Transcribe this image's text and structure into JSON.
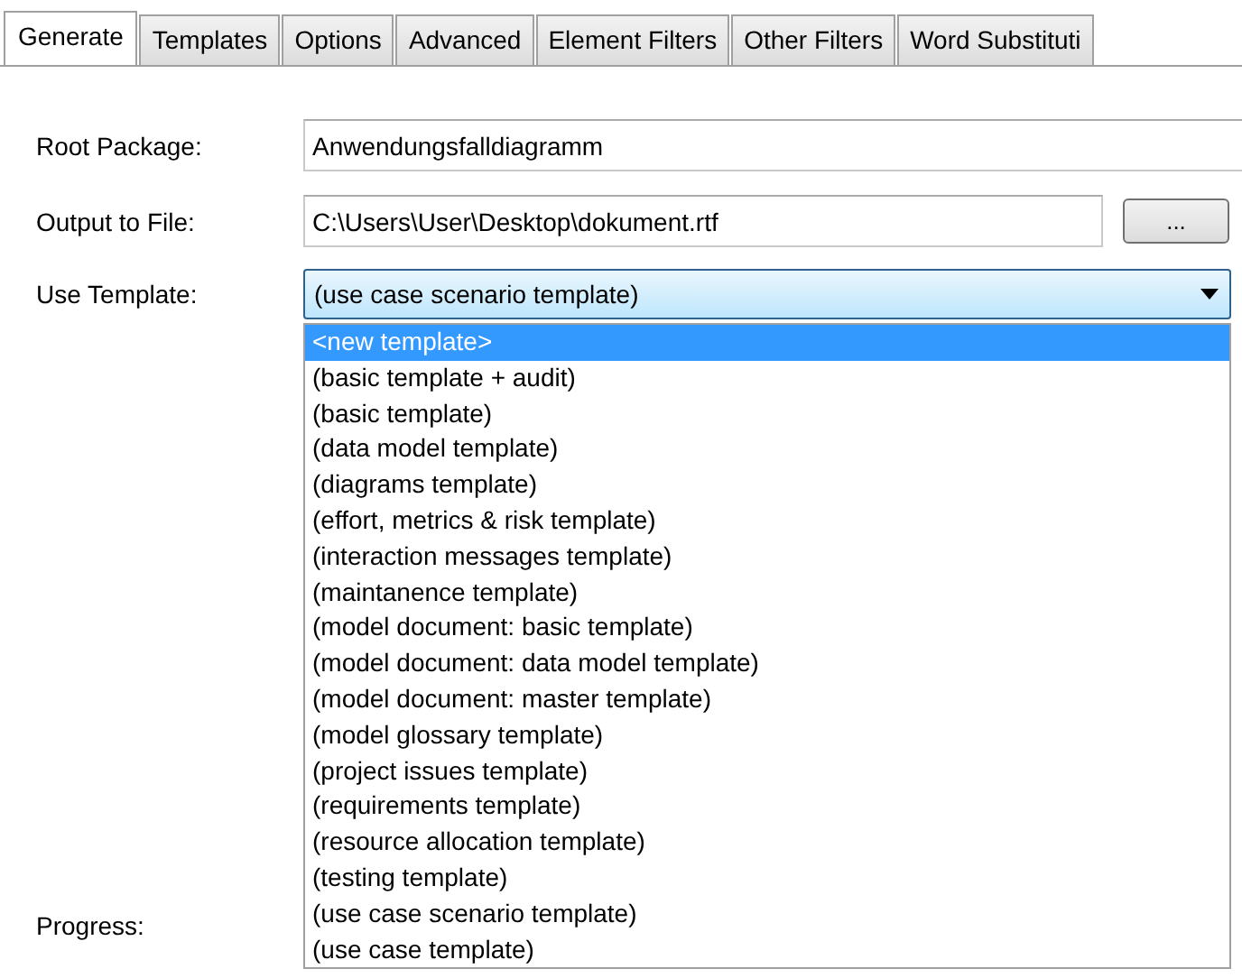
{
  "tabs": [
    {
      "label": "Generate",
      "selected": true
    },
    {
      "label": "Templates",
      "selected": false
    },
    {
      "label": "Options",
      "selected": false
    },
    {
      "label": "Advanced",
      "selected": false
    },
    {
      "label": "Element Filters",
      "selected": false
    },
    {
      "label": "Other Filters",
      "selected": false
    },
    {
      "label": "Word Substituti",
      "selected": false
    }
  ],
  "root_package": {
    "label": "Root Package:",
    "value": "Anwendungsfalldiagramm"
  },
  "output_file": {
    "label": "Output to File:",
    "value": "C:\\Users\\User\\Desktop\\dokument.rtf",
    "browse_button": "..."
  },
  "use_template": {
    "label": "Use Template:",
    "value": "(use case scenario template)",
    "expanded": true,
    "options": [
      {
        "label": "<new template>",
        "highlighted": true
      },
      {
        "label": "(basic template + audit)",
        "highlighted": false
      },
      {
        "label": "(basic template)",
        "highlighted": false
      },
      {
        "label": "(data model template)",
        "highlighted": false
      },
      {
        "label": "(diagrams template)",
        "highlighted": false
      },
      {
        "label": "(effort, metrics & risk template)",
        "highlighted": false
      },
      {
        "label": "(interaction messages template)",
        "highlighted": false
      },
      {
        "label": "(maintanence template)",
        "highlighted": false
      },
      {
        "label": "(model document: basic template)",
        "highlighted": false
      },
      {
        "label": "(model document: data model template)",
        "highlighted": false
      },
      {
        "label": "(model document: master template)",
        "highlighted": false
      },
      {
        "label": "(model glossary template)",
        "highlighted": false
      },
      {
        "label": "(project issues template)",
        "highlighted": false
      },
      {
        "label": "(requirements template)",
        "highlighted": false
      },
      {
        "label": "(resource allocation template)",
        "highlighted": false
      },
      {
        "label": "(testing template)",
        "highlighted": false
      },
      {
        "label": "(use case scenario template)",
        "highlighted": false
      },
      {
        "label": "(use case template)",
        "highlighted": false
      }
    ]
  },
  "progress": {
    "label": "Progress:"
  }
}
